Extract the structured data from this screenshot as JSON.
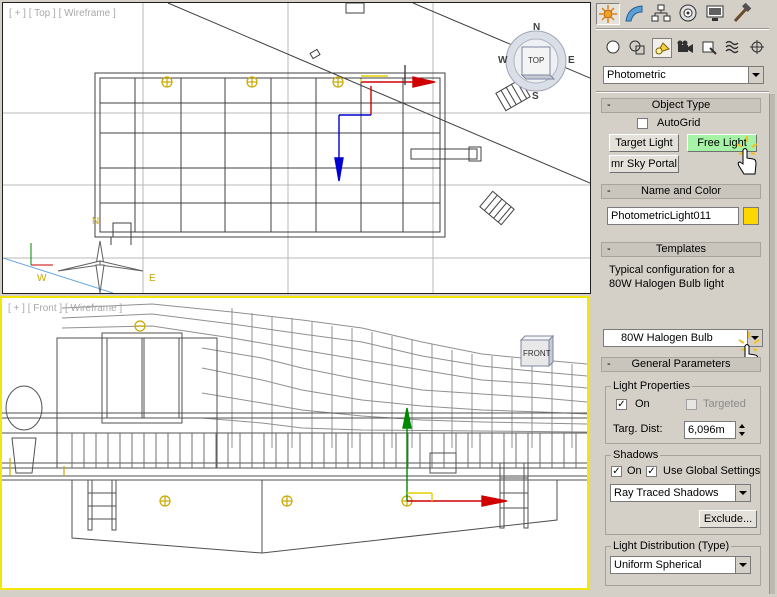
{
  "viewports": {
    "top": {
      "label": "[ + ] [ Top ] [ Wireframe ]",
      "compass": {
        "n": "N",
        "s": "S",
        "e": "E",
        "w": "W"
      },
      "viewcube_label": "TOP"
    },
    "front": {
      "label": "[ + ] [ Front ] [ Wireframe ]",
      "viewcube_label": "FRONT"
    }
  },
  "command_panel": {
    "tabs": [
      "create-tab",
      "modify-tab",
      "hierarchy-tab",
      "motion-tab",
      "display-tab",
      "utilities-tab"
    ],
    "subcategories": [
      "geometry",
      "shapes",
      "lights",
      "cameras",
      "helpers",
      "space-warps",
      "systems"
    ],
    "category_dropdown": "Photometric",
    "object_type": {
      "title": "Object Type",
      "autogrid_label": "AutoGrid",
      "target_light": "Target Light",
      "free_light": "Free Light",
      "mr_sky_portal": "mr Sky Portal"
    },
    "name_and_color": {
      "title": "Name and Color",
      "name_value": "PhotometricLight011",
      "color": "#ffd700"
    },
    "templates": {
      "title": "Templates",
      "description": "Typical configuration for a 80W Halogen Bulb light",
      "selected": "80W Halogen Bulb"
    },
    "general_parameters": {
      "title": "General Parameters",
      "light_properties_label": "Light Properties",
      "on_label": "On",
      "targeted_label": "Targeted",
      "targ_dist_label": "Targ. Dist:",
      "targ_dist_value": "6,096m",
      "shadows_label": "Shadows",
      "shadows_on_label": "On",
      "use_global_label": "Use Global Settings",
      "shadow_type": "Ray Traced Shadows",
      "exclude_button": "Exclude...",
      "light_distribution_label": "Light Distribution (Type)",
      "distribution_value": "Uniform Spherical"
    }
  },
  "colors": {
    "accent_green": "#a6f2a6",
    "viewport_highlight": "#f5e60a",
    "light_color": "#ffd700"
  }
}
